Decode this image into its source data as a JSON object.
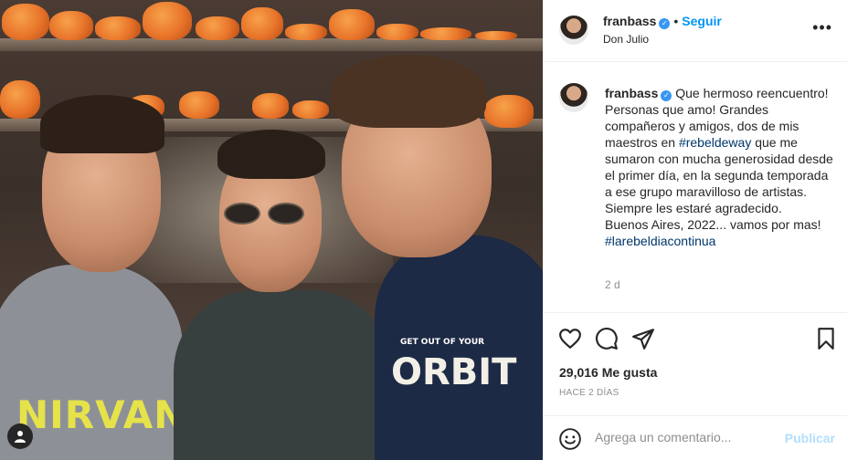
{
  "post": {
    "username": "franbass",
    "follow_label": "Seguir",
    "separator": "•",
    "location": "Don Julio",
    "more_icon": "more-horizontal-icon",
    "verified_icon": "verified-badge-icon",
    "verified_glyph": "✓"
  },
  "caption": {
    "username": "franbass",
    "text_before": "Que hermoso reencuentro! Personas que amo! Grandes compañeros y amigos, dos de mis maestros en ",
    "hashtag1": "#rebeldeway",
    "text_after": " que me sumaron con mucha generosidad desde el primer día, en la segunda temporada a ese grupo maravilloso de artistas. Siempre les estaré agradecido.",
    "line2": "Buenos Aires, 2022... vamos por mas!",
    "hashtag2": "#larebeldiacontinua",
    "time_ago": "2 d"
  },
  "actions": {
    "like_icon": "heart-icon",
    "comment_icon": "comment-bubble-icon",
    "share_icon": "paper-plane-icon",
    "save_icon": "bookmark-icon"
  },
  "stats": {
    "likes": "29,016 Me gusta",
    "date": "HACE 2 DÍAS"
  },
  "comment": {
    "emoji_icon": "smiley-icon",
    "placeholder": "Agrega un comentario...",
    "publish_label": "Publicar"
  },
  "photo": {
    "shirt_left": "NIRVANA",
    "shirt_right": "ORBIT",
    "shirt_right_small": "GET OUT OF YOUR",
    "user_tag_icon": "user-tag-icon"
  },
  "colors": {
    "link": "#0095f6",
    "hashtag": "#00376b",
    "verified": "#3897f0",
    "muted": "#8e8e8e",
    "publish_disabled": "#b2dffc"
  }
}
